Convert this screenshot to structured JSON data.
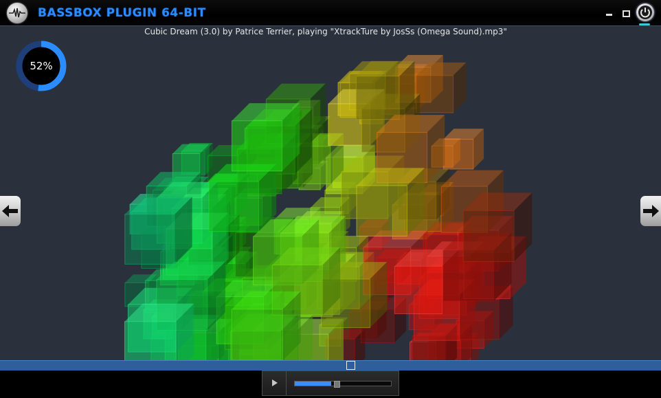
{
  "window": {
    "title": "BASSBOX PLUGIN 64-BIT"
  },
  "header": {
    "now_playing": "Cubic Dream (3.0) by Patrice Terrier, playing \"XtrackTure by JosSs (Omega Sound).mp3\""
  },
  "progress": {
    "percent": 52,
    "label": "52%"
  },
  "colors": {
    "accent": "#2a8cff",
    "seekbar": "#2f5f9b",
    "stage_bg": "#2a313c"
  },
  "icons": {
    "logo": "waveform-icon",
    "previous": "arrow-left-icon",
    "next": "arrow-right-icon",
    "power": "power-icon",
    "play": "play-icon"
  },
  "playback": {
    "position_fraction": 0.53,
    "volume_fraction": 0.38
  }
}
